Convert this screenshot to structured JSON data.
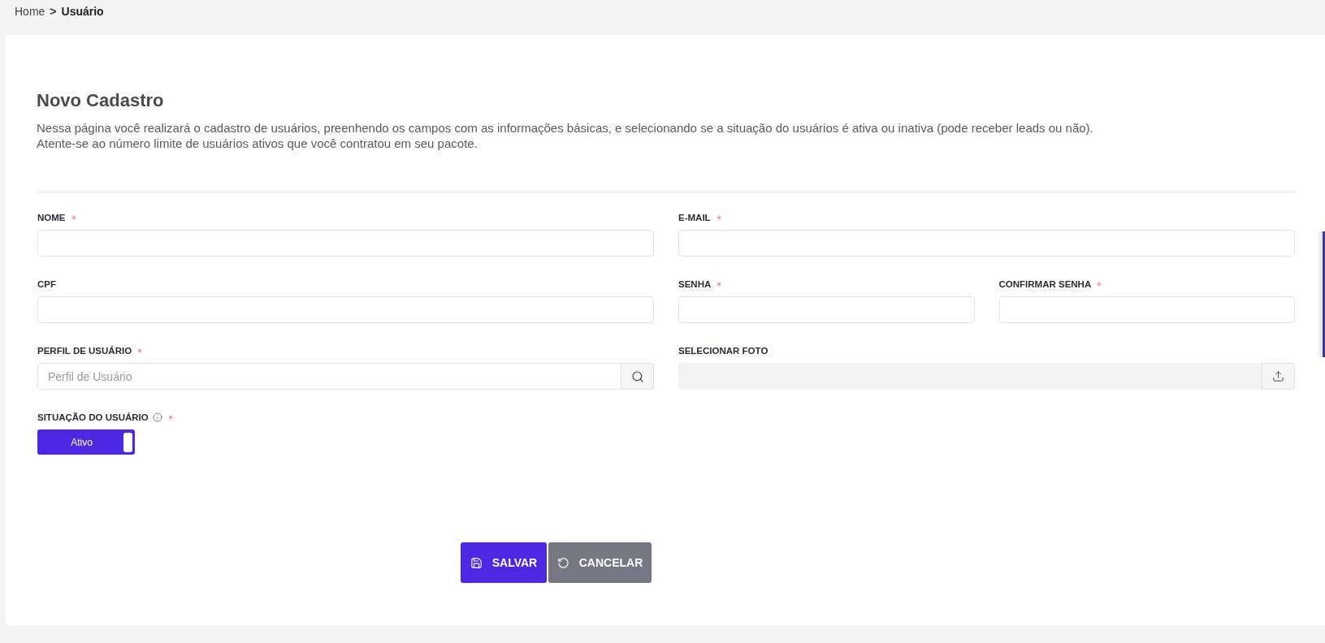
{
  "breadcrumb": {
    "items": [
      {
        "label": "Home",
        "current": false
      },
      {
        "label": "Usuário",
        "current": true
      }
    ],
    "separator": ">"
  },
  "page": {
    "title": "Novo Cadastro",
    "description": [
      "Nessa página você realizará o cadastro de usuários, preenhendo os campos com as informações básicas, e selecionando se a situação do usuários é ativa ou inativa (pode receber leads ou não).",
      "Atente-se ao número limite de usuários ativos que você contratou em seu pacote."
    ]
  },
  "form": {
    "rows": [
      [
        {
          "kind": "text",
          "label": "NOME",
          "required": true
        },
        {
          "kind": "text",
          "label": "E-MAIL",
          "required": true
        }
      ],
      [
        {
          "kind": "text",
          "label": "CPF",
          "required": false
        },
        {
          "kind": "text",
          "label": "SENHA",
          "required": true
        },
        {
          "kind": "text",
          "label": "CONFIRMAR SENHA",
          "required": true
        }
      ],
      [
        {
          "kind": "search",
          "label": "PERFIL DE USUÁRIO",
          "required": true,
          "placeholder": "Perfil de Usuário"
        },
        {
          "kind": "file",
          "label": "SELECIONAR FOTO",
          "required": false
        }
      ],
      [
        {
          "kind": "toggle",
          "label": "SITUAÇÃO DO USUÁRIO",
          "required": true,
          "info": true,
          "on": true,
          "value": "Ativo"
        }
      ]
    ]
  },
  "actions": [
    {
      "kind": "save",
      "label": "SALVAR"
    },
    {
      "kind": "cancel",
      "label": "CANCELAR"
    }
  ]
}
